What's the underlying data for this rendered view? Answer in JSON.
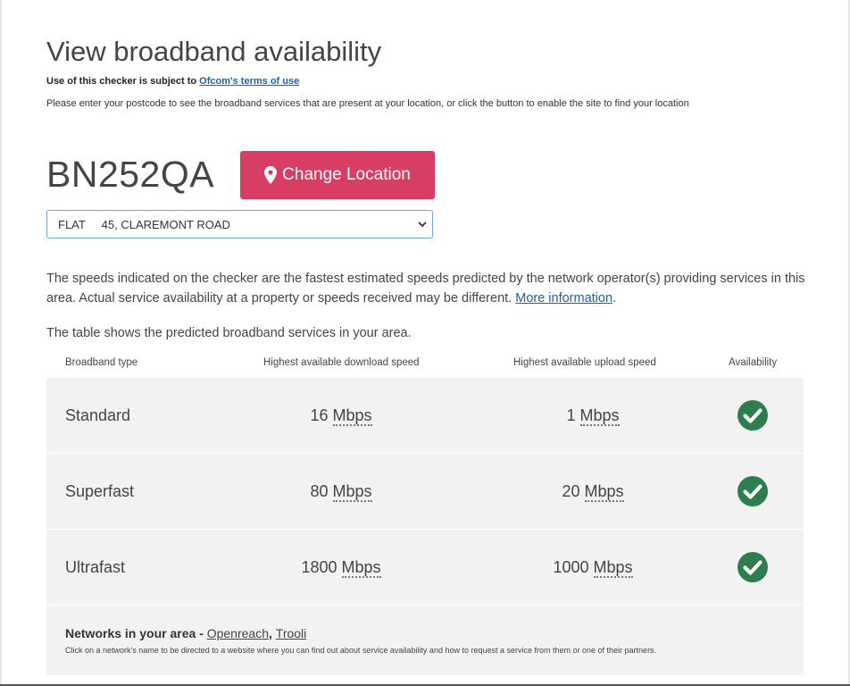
{
  "page": {
    "title": "View broadband availability",
    "terms_prefix": "Use of this checker is subject to ",
    "terms_link": "Ofcom's terms of use",
    "instructions": "Please enter your postcode to see the broadband services that are present at your location, or click the button to enable the site to find your location"
  },
  "location": {
    "postcode": "BN252QA",
    "change_button_label": "Change Location",
    "address_selected": "FLAT     45, CLAREMONT ROAD"
  },
  "info": {
    "speeds_text": "The speeds indicated on the checker are the fastest estimated speeds predicted by the network operator(s) providing services in this area. Actual service availability at a property or speeds received may be different. ",
    "more_info_link": "More information",
    "speeds_suffix": ".",
    "table_intro": "The table shows the predicted broadband services in your area."
  },
  "table": {
    "headers": [
      "Broadband type",
      "Highest available download speed",
      "Highest available upload speed",
      "Availability"
    ],
    "rows": [
      {
        "type": "Standard",
        "down_value": "16",
        "down_unit": "Mbps",
        "up_value": "1",
        "up_unit": "Mbps",
        "available": true
      },
      {
        "type": "Superfast",
        "down_value": "80",
        "down_unit": "Mbps",
        "up_value": "20",
        "up_unit": "Mbps",
        "available": true
      },
      {
        "type": "Ultrafast",
        "down_value": "1800",
        "down_unit": "Mbps",
        "up_value": "1000",
        "up_unit": "Mbps",
        "available": true
      }
    ],
    "networks_label": "Networks in your area - ",
    "networks": [
      "Openreach",
      "Trooli"
    ],
    "networks_separator": ", ",
    "networks_note": "Click on a network's name to be directed to a website where you can find out about service availability and how to request a service from them or one of their partners."
  },
  "colors": {
    "accent_button": "#d83d64",
    "check_green": "#2e7d4f",
    "link": "#1f5fa6",
    "table_bg": "#f2f2f2"
  },
  "icons": {
    "location": "map-pin-icon",
    "available": "check-circle-icon",
    "dropdown": "chevron-down-icon"
  }
}
